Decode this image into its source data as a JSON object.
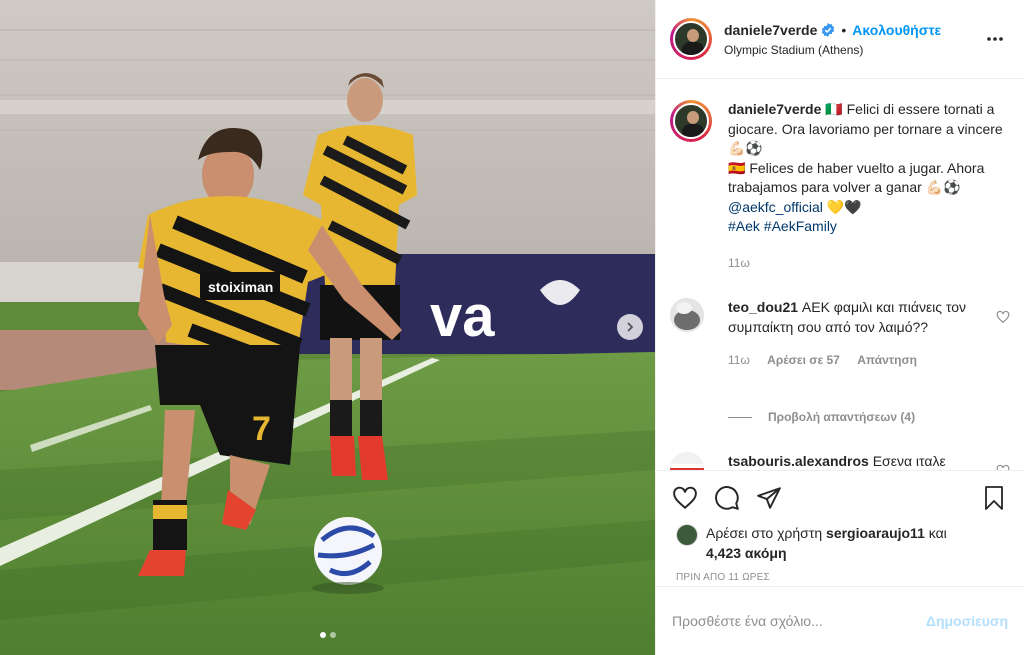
{
  "header": {
    "username": "daniele7verde",
    "separator": "•",
    "follow_label": "Ακολουθήστε",
    "location": "Olympic Stadium (Athens)",
    "more_icon": "ellipsis-icon"
  },
  "caption": {
    "username": "daniele7verde",
    "text_1": "🇮🇹 Felici di essere tornati a giocare. Ora lavoriamo per tornare a vincere 💪🏻⚽",
    "text_2": "🇪🇸 Felices de haber vuelto a jugar. Ahora trabajamos para volver a ganar 💪🏻⚽",
    "mention": "@aekfc_official",
    "emoji_end": "💛🖤",
    "hashtags": "#Aek #AekFamily",
    "time": "11ω"
  },
  "comments": [
    {
      "username": "teo_dou21",
      "text": "ΑΕΚ φαμιλι και πιάνεις τον συμπαίκτη σου από τον λαιμό??",
      "time": "11ω",
      "likes": "Αρέσει σε 57",
      "reply_label": "Απάντηση"
    },
    {
      "username": "tsabouris.alexandros",
      "text": "Εσενα ιταλε"
    }
  ],
  "view_replies": "Προβολή απαντήσεων (4)",
  "likes_line": {
    "prefix": "Αρέσει στο χρήστη",
    "user": "sergioaraujo11",
    "suffix": "και",
    "count": "4,423 ακόμη"
  },
  "posted_when": "ΠΡΙΝ ΑΠΟ 11 ΩΡΕΣ",
  "add_comment": {
    "placeholder": "Προσθέστε ένα σχόλιο...",
    "post_label": "Δημοσίευση"
  },
  "photo": {
    "player_number": "7",
    "sponsor_text": "stoiximan",
    "board_text": "va",
    "carousel_index": 1,
    "carousel_count": 2
  },
  "colors": {
    "accent": "#0095f6",
    "link": "#00376b",
    "muted": "#8e8e8e",
    "jersey_yellow": "#e8b732"
  }
}
